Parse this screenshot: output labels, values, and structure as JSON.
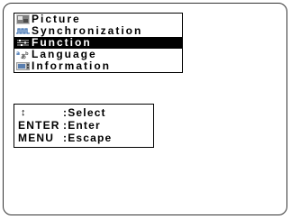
{
  "menu": {
    "items": [
      {
        "label": "Picture",
        "icon": "picture-icon",
        "selected": false
      },
      {
        "label": "Synchronization",
        "icon": "synchronization-icon",
        "selected": false
      },
      {
        "label": "Function",
        "icon": "function-icon",
        "selected": true
      },
      {
        "label": "Language",
        "icon": "language-icon",
        "selected": false
      },
      {
        "label": "Information",
        "icon": "information-icon",
        "selected": false
      }
    ]
  },
  "help": {
    "rows": [
      {
        "key": "↕",
        "sep": ":",
        "action": "Select"
      },
      {
        "key": "ENTER",
        "sep": ":",
        "action": "Enter"
      },
      {
        "key": "MENU",
        "sep": ":",
        "action": "Escape"
      }
    ]
  },
  "colors": {
    "selected_bg": "#000000",
    "selected_text": "#ffffff",
    "text": "#000000",
    "icon_blue": "#3b6fb0"
  }
}
